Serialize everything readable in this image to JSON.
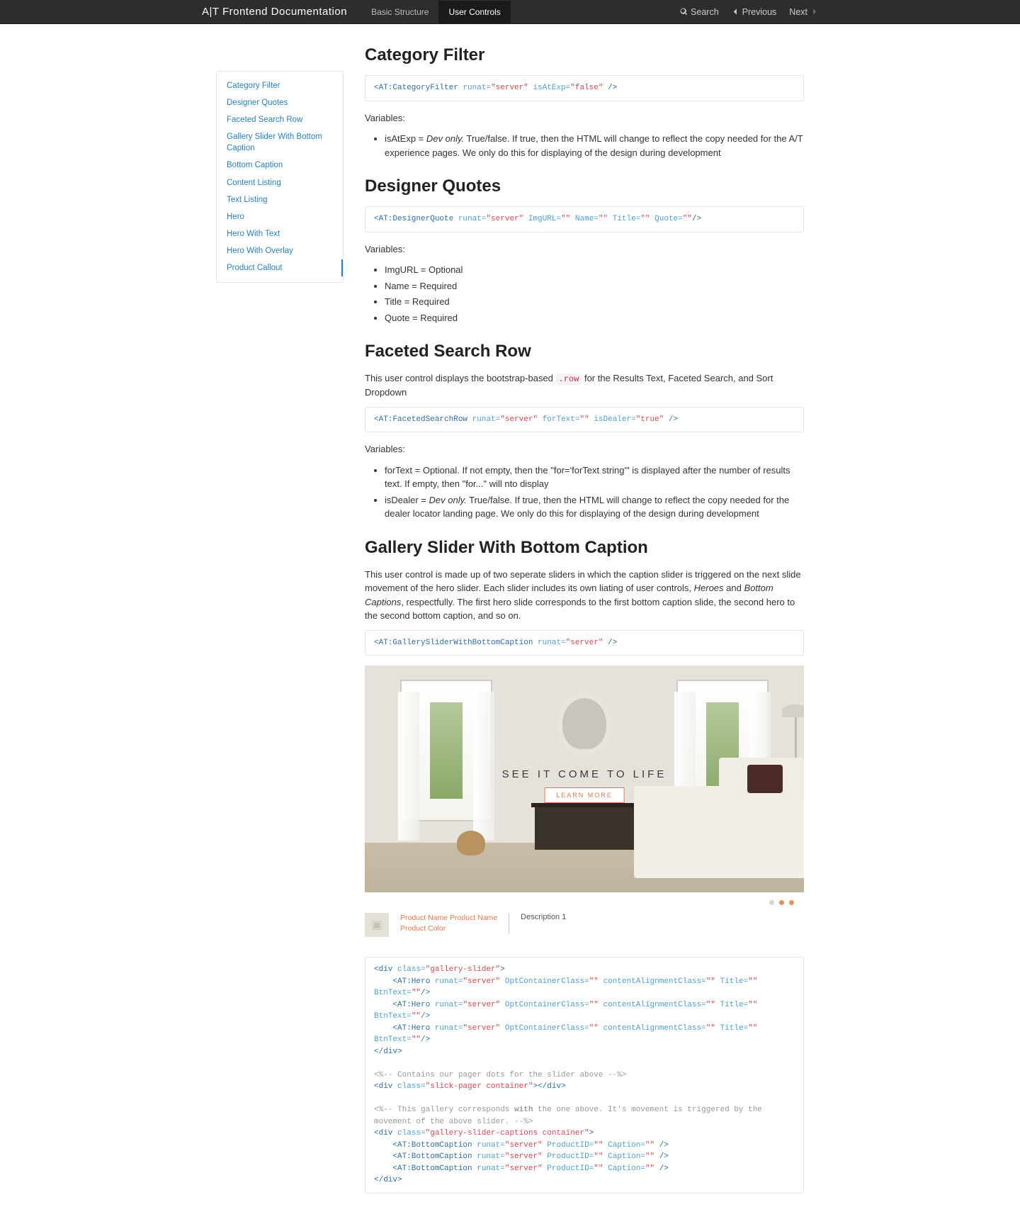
{
  "nav": {
    "brand": "A|T Frontend Documentation",
    "tabs": [
      "Basic Structure",
      "User Controls"
    ],
    "active_tab": 1,
    "search": "Search",
    "prev": "Previous",
    "next": "Next"
  },
  "sidebar": {
    "items": [
      "Category Filter",
      "Designer Quotes",
      "Faceted Search Row",
      "Gallery Slider With Bottom Caption",
      "Bottom Caption",
      "Content Listing",
      "Text Listing",
      "Hero",
      "Hero With Text",
      "Hero With Overlay",
      "Product Callout"
    ],
    "active": 10
  },
  "sec_catfilter": {
    "title": "Category Filter",
    "code_tag": "<AT:CategoryFilter",
    "code_attr1": "runat=",
    "code_val1": "\"server\"",
    "code_attr2": "isAtExp=",
    "code_val2": "\"false\"",
    "code_close": " />",
    "vars_label": "Variables:",
    "var1_a": "isAtExp = ",
    "var1_b": "Dev only.",
    "var1_c": " True/false. If true, then the HTML will change to reflect the copy needed for the A/T experience pages. We only do this for displaying of the design during development"
  },
  "sec_dq": {
    "title": "Designer Quotes",
    "code_tag": "<AT:DesignerQuote",
    "code_a1": "runat=",
    "code_v1": "\"server\"",
    "code_a2": "ImgURL=",
    "code_v2": "\"\"",
    "code_a3": "Name=",
    "code_v3": "\"\"",
    "code_a4": "Title=",
    "code_v4": "\"\"",
    "code_a5": "Quote=",
    "code_v5": "\"\"",
    "code_close": "/>",
    "vars_label": "Variables:",
    "vars": [
      "ImgURL = Optional",
      "Name = Required",
      "Title = Required",
      "Quote = Required"
    ]
  },
  "sec_facet": {
    "title": "Faceted Search Row",
    "intro_a": "This user control displays the bootstrap-based ",
    "intro_code": ".row",
    "intro_b": " for the Results Text, Faceted Search, and Sort Dropdown",
    "code_tag": "<AT:FacetedSearchRow",
    "code_a1": "runat=",
    "code_v1": "\"server\"",
    "code_a2": "forText=",
    "code_v2": "\"\"",
    "code_a3": "isDealer=",
    "code_v3": "\"true\"",
    "code_close": " />",
    "vars_label": "Variables:",
    "var1": "forText = Optional. If not empty, then the \"for='forText string'\" is displayed after the number of results text. If empty, then \"for...\" will nto display",
    "var2_a": "isDealer = ",
    "var2_b": "Dev only.",
    "var2_c": " True/false. If true, then the HTML will change to reflect the copy needed for the dealer locator landing page. We only do this for displaying of the design during development"
  },
  "sec_gallery": {
    "title": "Gallery Slider With Bottom Caption",
    "intro_a": "This user control is made up of two seperate sliders in which the caption slider is triggered on the next slide movement of the hero slider. Each slider includes its own liating of user controls, ",
    "intro_i1": "Heroes",
    "intro_mid": " and ",
    "intro_i2": "Bottom Captions",
    "intro_b": ", respectfully. The first hero slide corresponds to the first bottom caption slide, the second hero to the second bottom caption, and so on.",
    "code_tag": "<AT:GallerySliderWithBottomCaption",
    "code_a1": "runat=",
    "code_v1": "\"server\"",
    "code_close": " />",
    "hero_title": "SEE IT COME TO LIFE",
    "hero_btn": "LEARN MORE",
    "thumb_name": "Product Name Product Name",
    "thumb_color": "Product Color",
    "thumb_desc": "Description 1",
    "code2_l1a": "<div ",
    "code2_l1b": "class=",
    "code2_l1c": "\"gallery-slider\"",
    "code2_l1d": ">",
    "code2_hero_tag": "<AT:Hero",
    "code2_hero_a1": "runat=",
    "code2_hero_v1": "\"server\"",
    "code2_hero_a2": "OptContainerClass=",
    "code2_hero_v2": "\"\"",
    "code2_hero_a3": "contentAlignmentClass=",
    "code2_hero_v3": "\"\"",
    "code2_hero_a4": "Title=",
    "code2_hero_v4": "\"\"",
    "code2_hero_a5": "BtnText=",
    "code2_hero_v5": "\"\"",
    "code2_hero_close": "/>",
    "code2_divclose": "</div>",
    "code2_com1": "<%-- Contains our pager dots for the slider above --%>",
    "code2_sp_a": "<div ",
    "code2_sp_b": "class=",
    "code2_sp_c": "\"slick-pager container\"",
    "code2_sp_d": "></div>",
    "code2_com2a": "<%-- This gallery corresponds ",
    "code2_com2b": "with",
    "code2_com2c": " the one above. It's movement is triggered by the movement of the above slider. --%>",
    "code2_cap_a": "<div ",
    "code2_cap_b": "class=",
    "code2_cap_c": "\"gallery-slider-captions container\"",
    "code2_cap_d": ">",
    "code2_bc_tag": "<AT:BottomCaption",
    "code2_bc_a1": "runat=",
    "code2_bc_v1": "\"server\"",
    "code2_bc_a2": "ProductID=",
    "code2_bc_v2": "\"\"",
    "code2_bc_a3": "Caption=",
    "code2_bc_v3": "\"\"",
    "code2_bc_close": " />"
  }
}
